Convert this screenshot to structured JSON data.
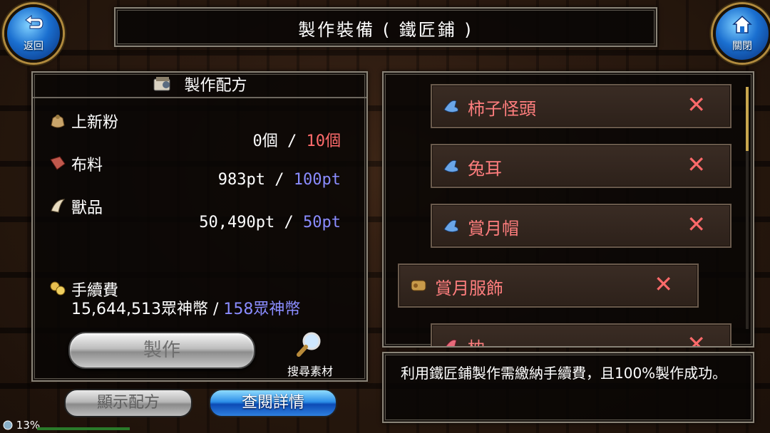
{
  "header": {
    "title": "製作裝備 ( 鐵匠鋪 )",
    "back_label": "返回",
    "close_label": "關閉"
  },
  "recipe_panel": {
    "title": "製作配方",
    "materials": [
      {
        "name": "上新粉",
        "owned": "0個",
        "separator": "/",
        "required": "10個",
        "required_color": "red",
        "icon": "pouch-icon"
      },
      {
        "name": "布料",
        "owned": "983pt",
        "separator": "/",
        "required": "100pt",
        "required_color": "blue",
        "icon": "cloth-icon"
      },
      {
        "name": "獸品",
        "owned": "50,490pt",
        "separator": "/",
        "required": "50pt",
        "required_color": "blue",
        "icon": "fang-icon"
      }
    ],
    "fee": {
      "label": "手續費",
      "owned": "15,644,513眾神幣",
      "separator": "/",
      "required": "158眾神幣",
      "icon": "coins-icon"
    },
    "craft_button": "製作",
    "search_materials": "搜尋素材"
  },
  "bottom_buttons": {
    "show_recipe": "顯示配方",
    "view_details": "查閱詳情"
  },
  "recipe_list": [
    {
      "name": "柿子怪頭",
      "icon": "hat-icon"
    },
    {
      "name": "兔耳",
      "icon": "hat-icon"
    },
    {
      "name": "賞月帽",
      "icon": "hat-icon"
    },
    {
      "name": "賞月服飾",
      "icon": "outfit-icon"
    },
    {
      "name": "枕",
      "icon": "hat-icon"
    }
  ],
  "remove_symbol": "✕",
  "info": {
    "text": "利用鐵匠鋪製作需繳納手續費，且100%製作成功。"
  },
  "status": {
    "percent": "13%"
  },
  "colors": {
    "required_insufficient": "#ff6b6b",
    "required_ok": "#8a8cff",
    "recipe_name": "#ff7e7e"
  }
}
